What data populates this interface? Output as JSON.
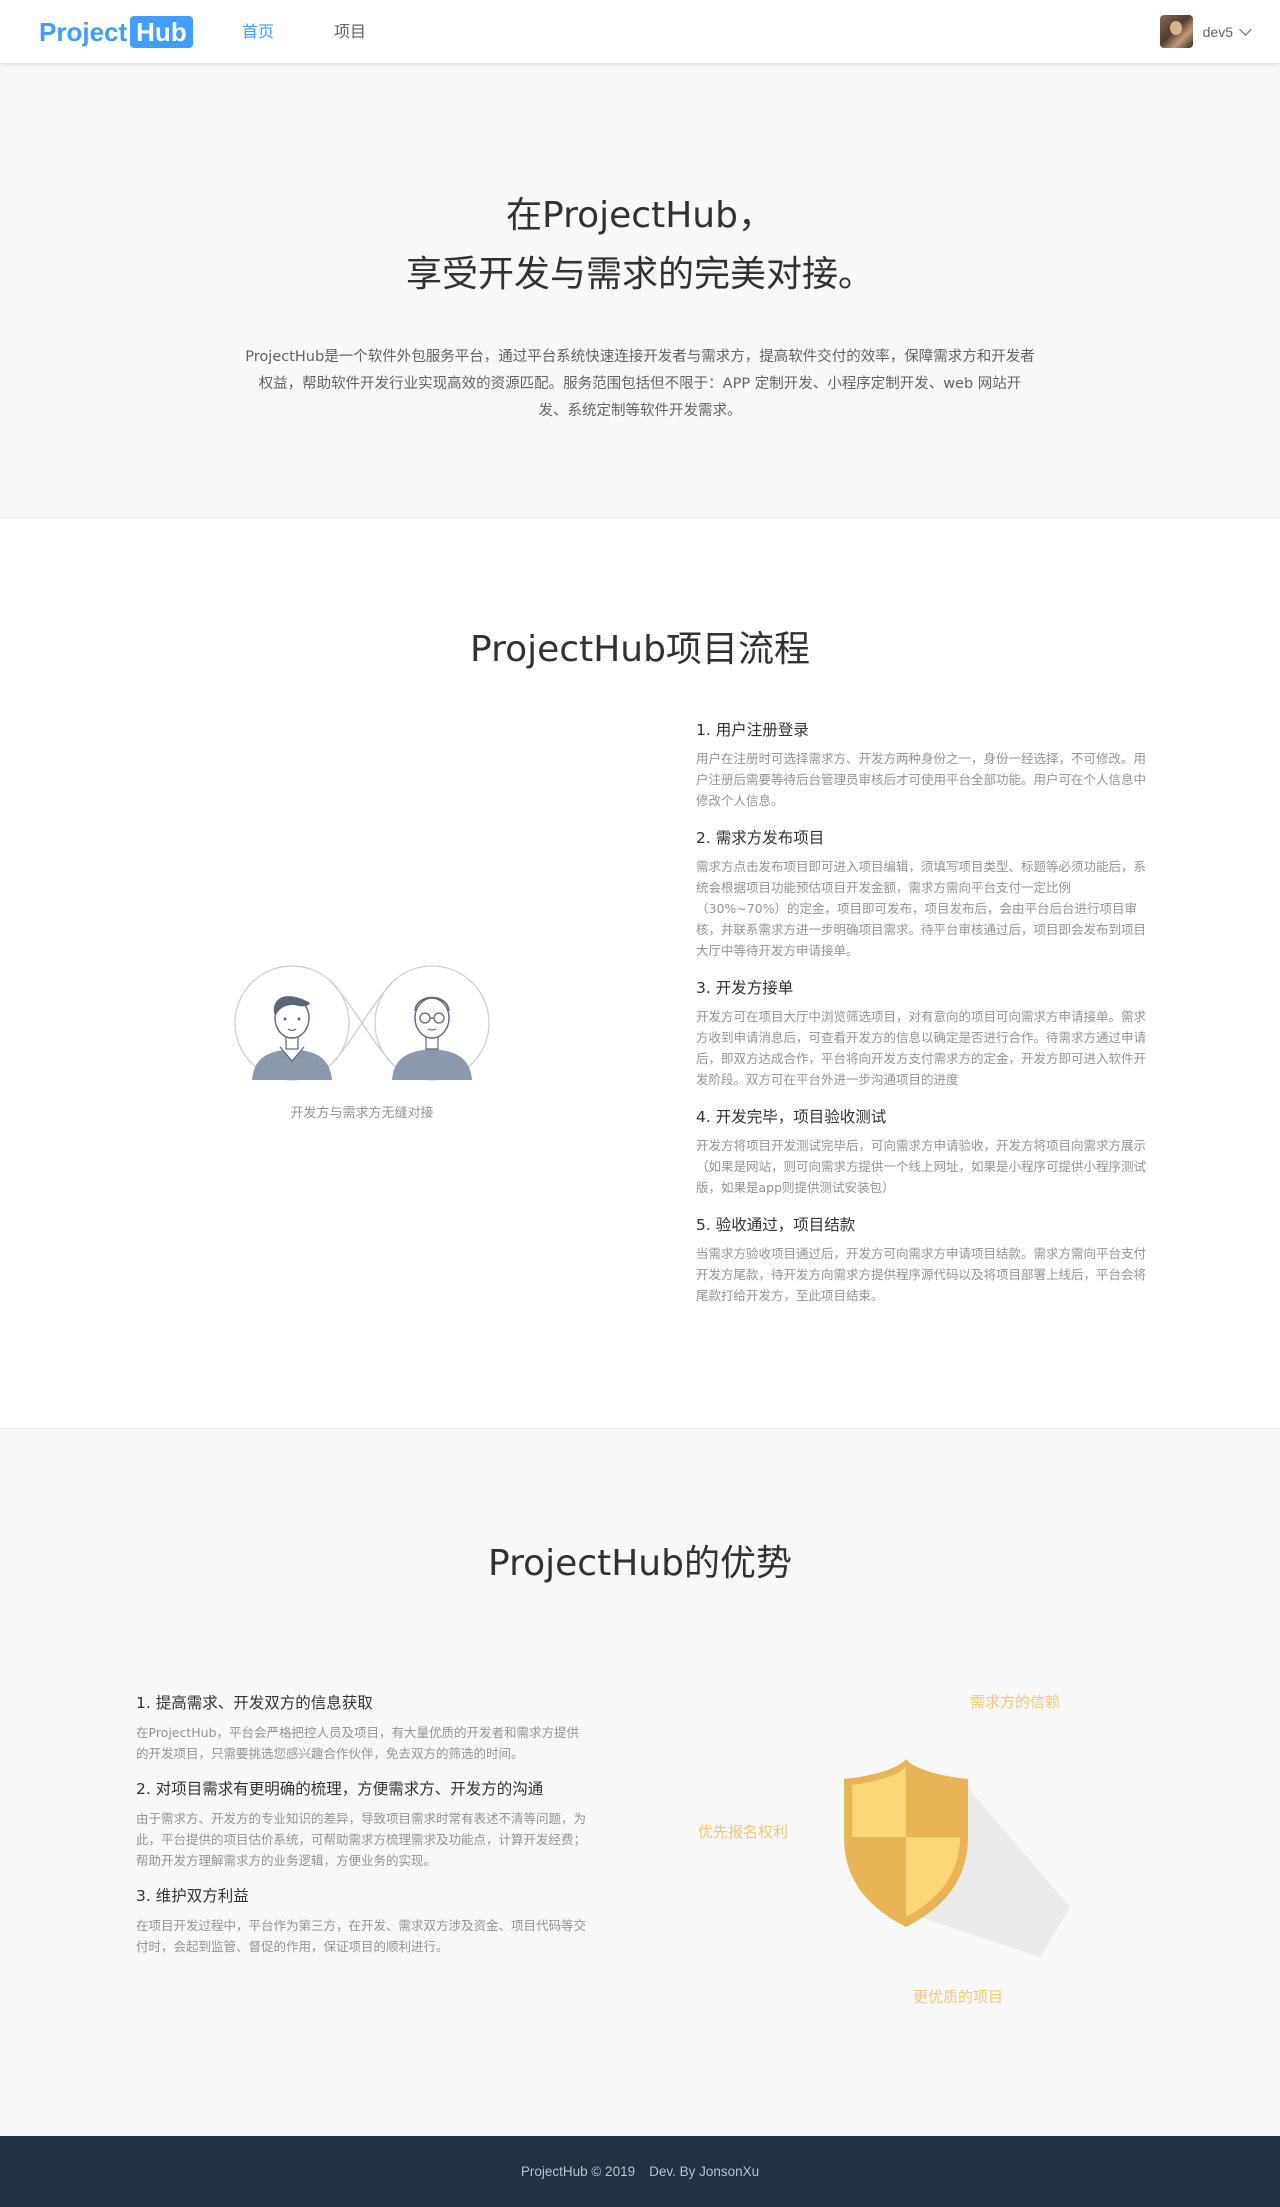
{
  "header": {
    "logo_part1": "Project",
    "logo_part2": "Hub",
    "nav": [
      {
        "label": "首页",
        "active": true
      },
      {
        "label": "项目",
        "active": false
      }
    ],
    "user": {
      "name": "dev5"
    }
  },
  "hero": {
    "title_line1": "在ProjectHub，",
    "title_line2": "享受开发与需求的完美对接。",
    "description": "ProjectHub是一个软件外包服务平台，通过平台系统快速连接开发者与需求方，提高软件交付的效率，保障需求方和开发者权益，帮助软件开发行业实现高效的资源匹配。服务范围包括但不限于：APP 定制开发、小程序定制开发、web 网站开发、系统定制等软件开发需求。"
  },
  "process": {
    "title": "ProjectHub项目流程",
    "illustration_caption": "开发方与需求方无缝对接",
    "steps": [
      {
        "title": "1. 用户注册登录",
        "text": "用户在注册时可选择需求方、开发方两种身份之一，身份一经选择，不可修改。用户注册后需要等待后台管理员审核后才可使用平台全部功能。用户可在个人信息中修改个人信息。"
      },
      {
        "title": "2. 需求方发布项目",
        "text": "需求方点击发布项目即可进入项目编辑，须填写项目类型、标题等必须功能后，系统会根据项目功能预估项目开发金额，需求方需向平台支付一定比例（30%~70%）的定金，项目即可发布，项目发布后，会由平台后台进行项目审核，并联系需求方进一步明确项目需求。待平台审核通过后，项目即会发布到项目大厅中等待开发方申请接单。"
      },
      {
        "title": "3. 开发方接单",
        "text": "开发方可在项目大厅中浏览筛选项目，对有意向的项目可向需求方申请接单。需求方收到申请消息后，可查看开发方的信息以确定是否进行合作。待需求方通过申请后，即双方达成合作，平台将向开发方支付需求方的定金，开发方即可进入软件开发阶段。双方可在平台外进一步沟通项目的进度"
      },
      {
        "title": "4. 开发完毕，项目验收测试",
        "text": "开发方将项目开发测试完毕后，可向需求方申请验收，开发方将项目向需求方展示（如果是网站，则可向需求方提供一个线上网址，如果是小程序可提供小程序测试版，如果是app则提供测试安装包）"
      },
      {
        "title": "5. 验收通过，项目结款",
        "text": "当需求方验收项目通过后，开发方可向需求方申请项目结款。需求方需向平台支付开发方尾款，待开发方向需求方提供程序源代码以及将项目部署上线后，平台会将尾款打给开发方，至此项目结束。"
      }
    ]
  },
  "advantages": {
    "title": "ProjectHub的优势",
    "items": [
      {
        "title": "1. 提高需求、开发双方的信息获取",
        "text": "在ProjectHub，平台会严格把控人员及项目，有大量优质的开发者和需求方提供的开发项目，只需要挑选您感兴趣合作伙伴，免去双方的筛选的时间。"
      },
      {
        "title": "2. 对项目需求有更明确的梳理，方便需求方、开发方的沟通",
        "text": "由于需求方、开发方的专业知识的差异，导致项目需求时常有表述不清等问题，为此，平台提供的项目估价系统，可帮助需求方梳理需求及功能点，计算开发经费；帮助开发方理解需求方的业务逻辑，方便业务的实现。"
      },
      {
        "title": "3. 维护双方利益",
        "text": "在项目开发过程中，平台作为第三方，在开发、需求双方涉及资金、项目代码等交付时，会起到监管、督促的作用，保证项目的顺利进行。"
      }
    ],
    "shield_labels": {
      "trust": "需求方的信赖",
      "priority": "优先报名权利",
      "quality": "更优质的项目"
    }
  },
  "footer": {
    "copyright": "ProjectHub  © 2019",
    "author": "Dev. By JonsonXu"
  },
  "colors": {
    "brand": "#409eff",
    "footer_bg": "#223242",
    "shield_gold": "#f0b84a",
    "shield_label": "#f0c97a"
  }
}
